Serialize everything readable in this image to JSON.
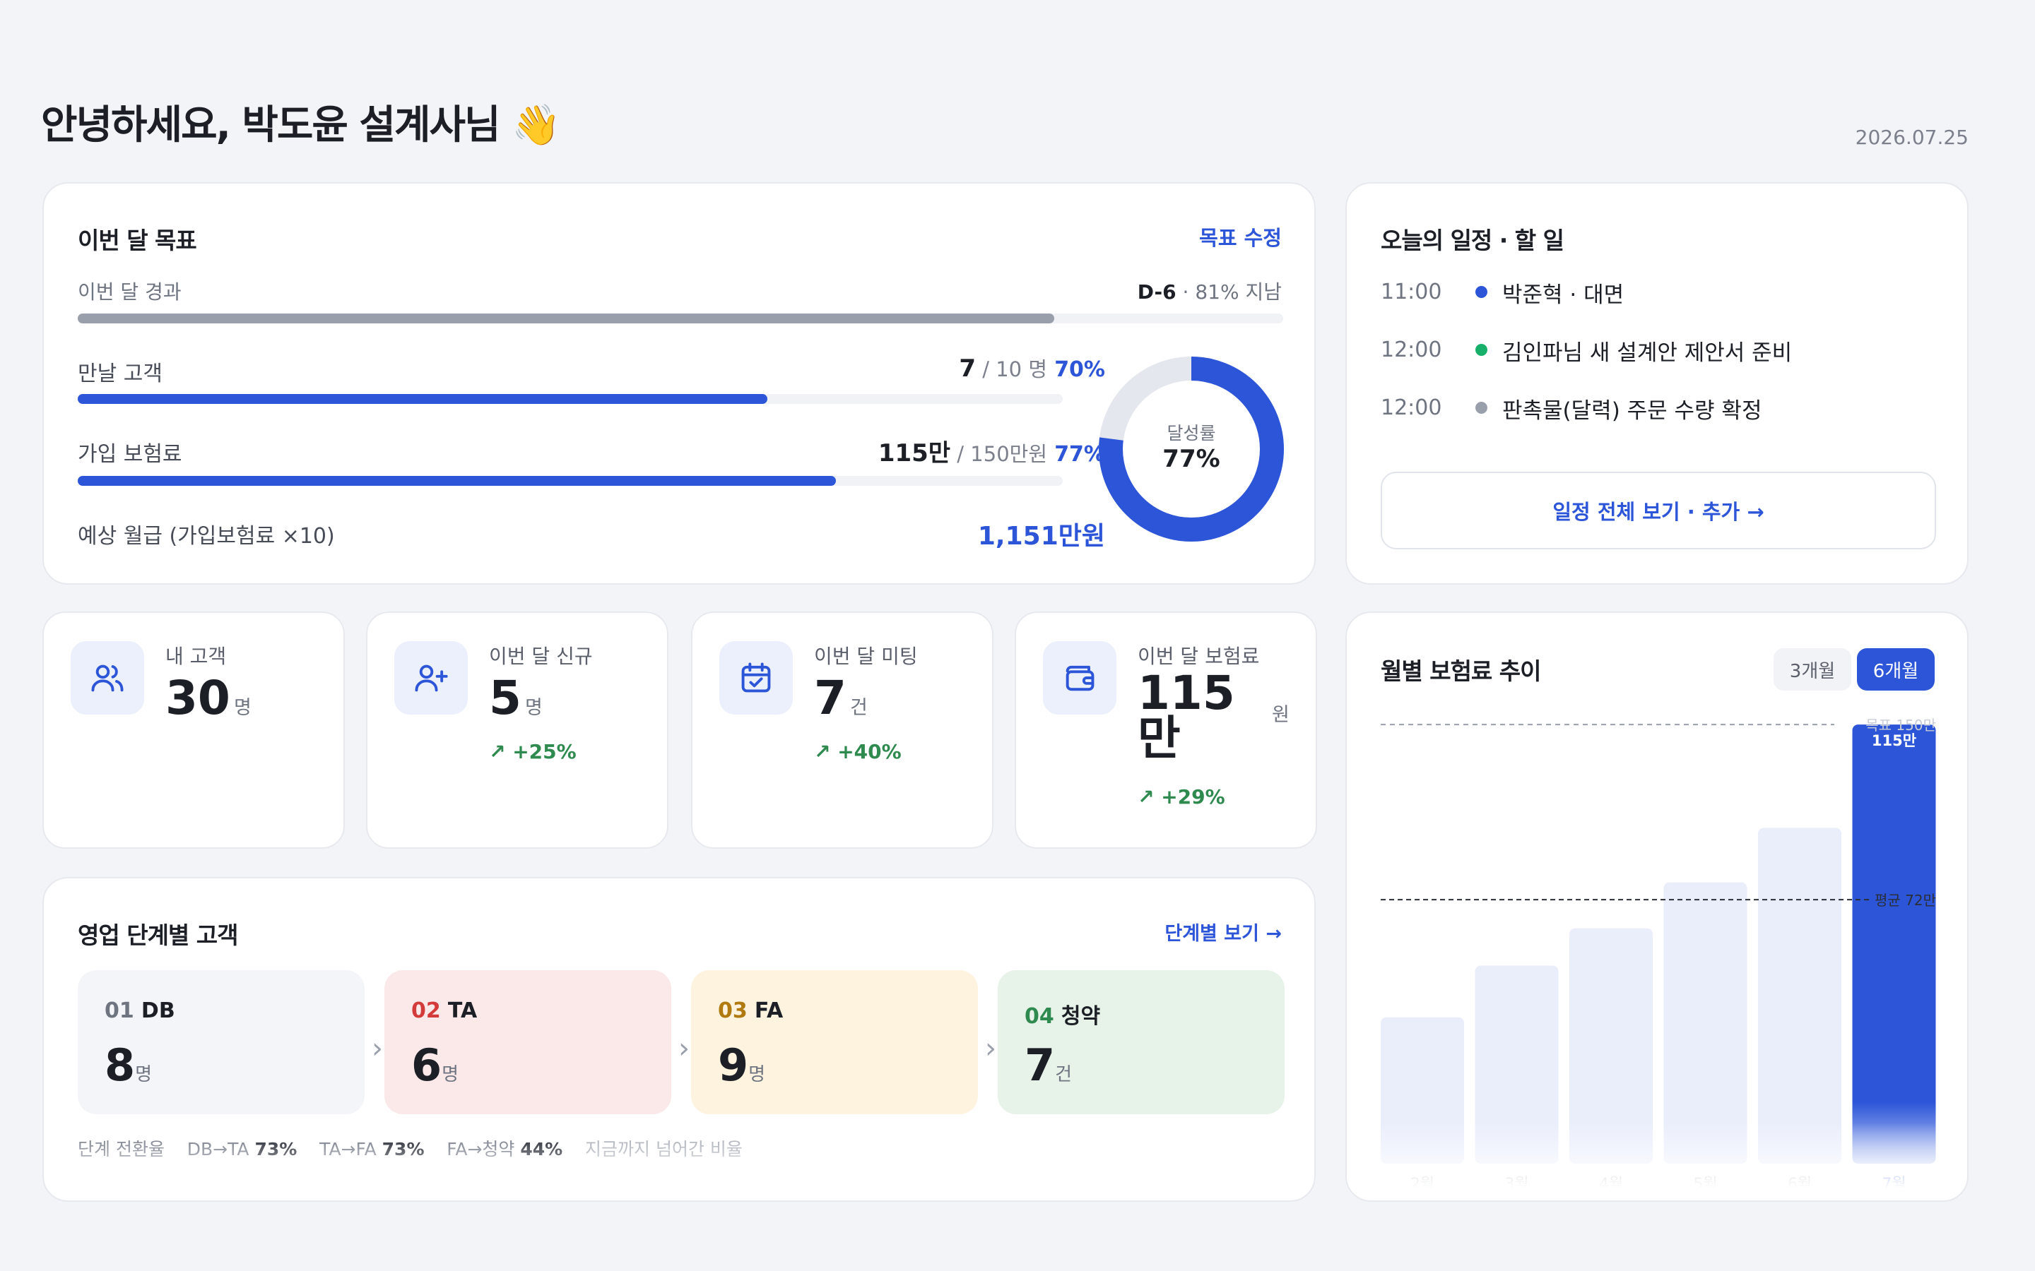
{
  "greeting": "안녕하세요, 박도윤 설계사님 👋",
  "date": "2026.07.25",
  "goal": {
    "title": "이번 달 목표",
    "edit_label": "목표 수정",
    "elapsed": {
      "label": "이번 달 경과",
      "dday": "D-6",
      "rest": " · 81% 지남",
      "progress": 0.81
    },
    "clients": {
      "label": "만날 고객",
      "value": "7",
      "target": " / 10 명",
      "pct": "70%",
      "progress": 0.7
    },
    "premium": {
      "label": "가입 보험료",
      "value": "115만",
      "target": " / 150만원",
      "pct": "77%",
      "progress": 0.77
    },
    "salary": {
      "label": "예상 월급 (가입보험료 ×10)",
      "value": "1,151만원"
    },
    "donut": {
      "label": "달성률",
      "value": "77%",
      "progress": 0.77
    }
  },
  "schedule": {
    "title": "오늘의 일정 · 할 일",
    "items": [
      {
        "time": "11:00",
        "text": "박준혁 · 대면",
        "color": "#2c55d8"
      },
      {
        "time": "12:00",
        "text": "김인파님 새 설계안 제안서 준비",
        "color": "#17b06b"
      },
      {
        "time": "12:00",
        "text": "판촉물(달력) 주문 수량 확정",
        "color": "#9aa0ab"
      }
    ],
    "button": "일정 전체 보기 · 추가 →"
  },
  "stats": [
    {
      "label": "내 고객",
      "value": "30",
      "unit": "명",
      "delta": "",
      "icon": "users-icon"
    },
    {
      "label": "이번 달 신규",
      "value": "5",
      "unit": "명",
      "delta": "↗ +25%",
      "icon": "user-plus-icon"
    },
    {
      "label": "이번 달 미팅",
      "value": "7",
      "unit": "건",
      "delta": "↗ +40%",
      "icon": "calendar-check-icon"
    },
    {
      "label": "이번 달 보험료",
      "value": "115",
      "value2": "만",
      "unit": "원",
      "delta": "↗ +29%",
      "icon": "wallet-icon"
    }
  ],
  "stages": {
    "title": "영업 단계별 고객",
    "link": "단계별 보기 →",
    "items": [
      {
        "num": "01",
        "name": "DB",
        "value": "8",
        "unit": "명",
        "bg": "#f4f5f8",
        "color": "#6f7481"
      },
      {
        "num": "02",
        "name": "TA",
        "value": "6",
        "unit": "명",
        "bg": "#fbe9e9",
        "color": "#d33a3a"
      },
      {
        "num": "03",
        "name": "FA",
        "value": "9",
        "unit": "명",
        "bg": "#fdf3df",
        "color": "#b07a10"
      },
      {
        "num": "04",
        "name": "청약",
        "value": "7",
        "unit": "건",
        "bg": "#e7f2e8",
        "color": "#2e8a4f"
      }
    ],
    "conversion": {
      "label": "단계 전환율",
      "items": [
        {
          "label": "DB→TA",
          "value": "73%"
        },
        {
          "label": "TA→FA",
          "value": "73%"
        },
        {
          "label": "FA→청약",
          "value": "44%"
        }
      ],
      "note": "지금까지 넘어간 비율"
    }
  },
  "trend": {
    "title": "월별 보험료 추이",
    "tabs": [
      {
        "label": "3개월",
        "active": false
      },
      {
        "label": "6개월",
        "active": true
      }
    ],
    "accent": "#2c55d8",
    "chart_data": {
      "type": "bar",
      "categories": [
        "2월",
        "3월",
        "4월",
        "5월",
        "6월",
        "7월"
      ],
      "values": [
        51,
        69,
        82,
        98,
        117,
        153
      ],
      "highlight_index": 5,
      "highlight_label": "115만",
      "goal_line": {
        "value": 153,
        "label": "목표 150만"
      },
      "avg_line": {
        "value": 92,
        "label": "평균 72만"
      },
      "ylim": [
        0,
        155
      ]
    }
  }
}
